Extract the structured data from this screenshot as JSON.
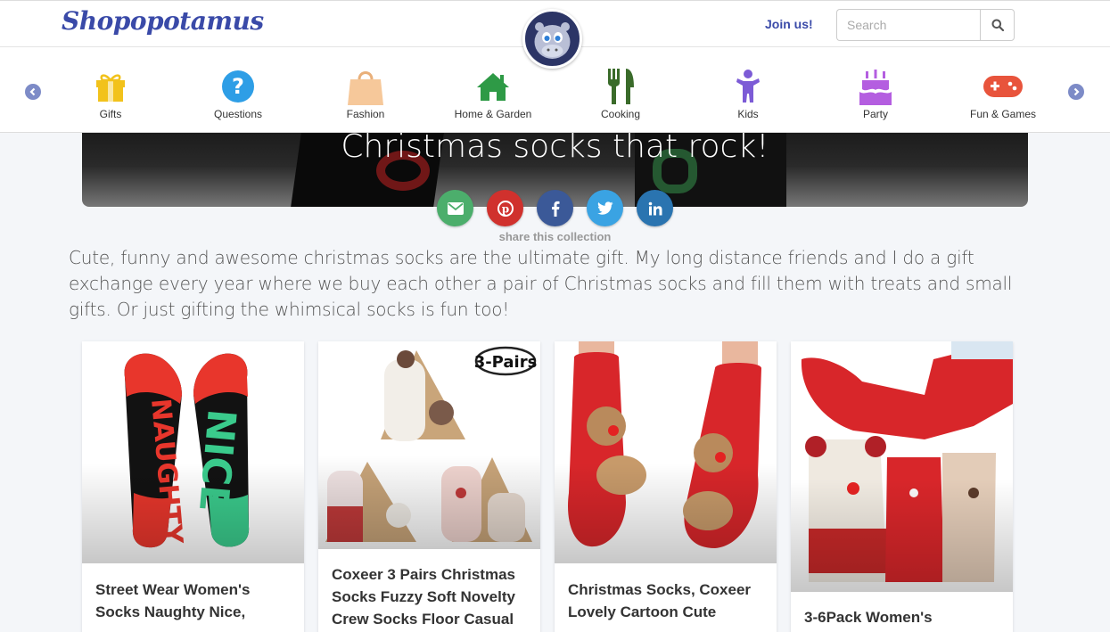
{
  "header": {
    "logo": "Shopopotamus",
    "join_label": "Join us!",
    "search_placeholder": "Search",
    "search_icon": "search-icon"
  },
  "categories": [
    {
      "label": "Gifts",
      "icon": "gift-icon",
      "color": "#f2c21b"
    },
    {
      "label": "Questions",
      "icon": "question-icon",
      "color": "#2e9ee6"
    },
    {
      "label": "Fashion",
      "icon": "shopping-bag-icon",
      "color": "#f6c89a"
    },
    {
      "label": "Home & Garden",
      "icon": "house-icon",
      "color": "#2e9a46"
    },
    {
      "label": "Cooking",
      "icon": "fork-knife-icon",
      "color": "#3a6b2a"
    },
    {
      "label": "Kids",
      "icon": "child-icon",
      "color": "#7c5bd6"
    },
    {
      "label": "Party",
      "icon": "cake-icon",
      "color": "#b45ee0"
    },
    {
      "label": "Fun & Games",
      "icon": "gamepad-icon",
      "color": "#e8543c"
    }
  ],
  "collection": {
    "title": "Christmas socks that rock!",
    "share_label": "share this collection",
    "description": "Cute, funny and awesome christmas socks are the ultimate gift. My long distance friends and I do a gift exchange every year where we buy each other a pair of Christmas socks and fill them with treats and small gifts. Or just gifting the whimsical socks is fun too!"
  },
  "share_buttons": [
    {
      "icon": "envelope-icon",
      "color": "#4cae6c"
    },
    {
      "icon": "pinterest-icon",
      "color": "#d0312d"
    },
    {
      "icon": "facebook-icon",
      "color": "#3b5998"
    },
    {
      "icon": "twitter-icon",
      "color": "#3aa3e3"
    },
    {
      "icon": "linkedin-icon",
      "color": "#2a74b0"
    }
  ],
  "products": [
    {
      "name": "Street Wear Women's Socks Naughty Nice,"
    },
    {
      "name": "Coxeer 3 Pairs Christmas Socks Fuzzy Soft Novelty Crew Socks Floor Casual",
      "badge": "3-Pairs"
    },
    {
      "name": "Christmas Socks, Coxeer Lovely Cartoon Cute"
    },
    {
      "name": "3-6Pack Women's"
    }
  ],
  "sock_text": {
    "left": "NAUGHTY",
    "right": "NICE"
  }
}
